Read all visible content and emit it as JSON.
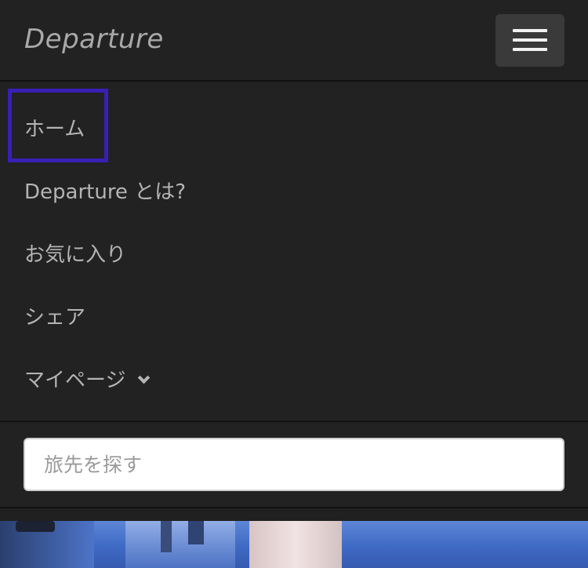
{
  "navbar": {
    "brand": "Departure",
    "toggle_icon": "hamburger-menu-icon"
  },
  "menu": {
    "items": [
      {
        "label": "ホーム",
        "focused": true
      },
      {
        "label": "Departure とは?"
      },
      {
        "label": "お気に入り"
      },
      {
        "label": "シェア"
      },
      {
        "label": "マイページ",
        "icon": "chevron-down-icon"
      }
    ]
  },
  "search": {
    "placeholder": "旅先を探す",
    "value": ""
  },
  "colors": {
    "background": "#222222",
    "focus_outline": "#3a1fb5",
    "text": "#b4b4b4"
  }
}
